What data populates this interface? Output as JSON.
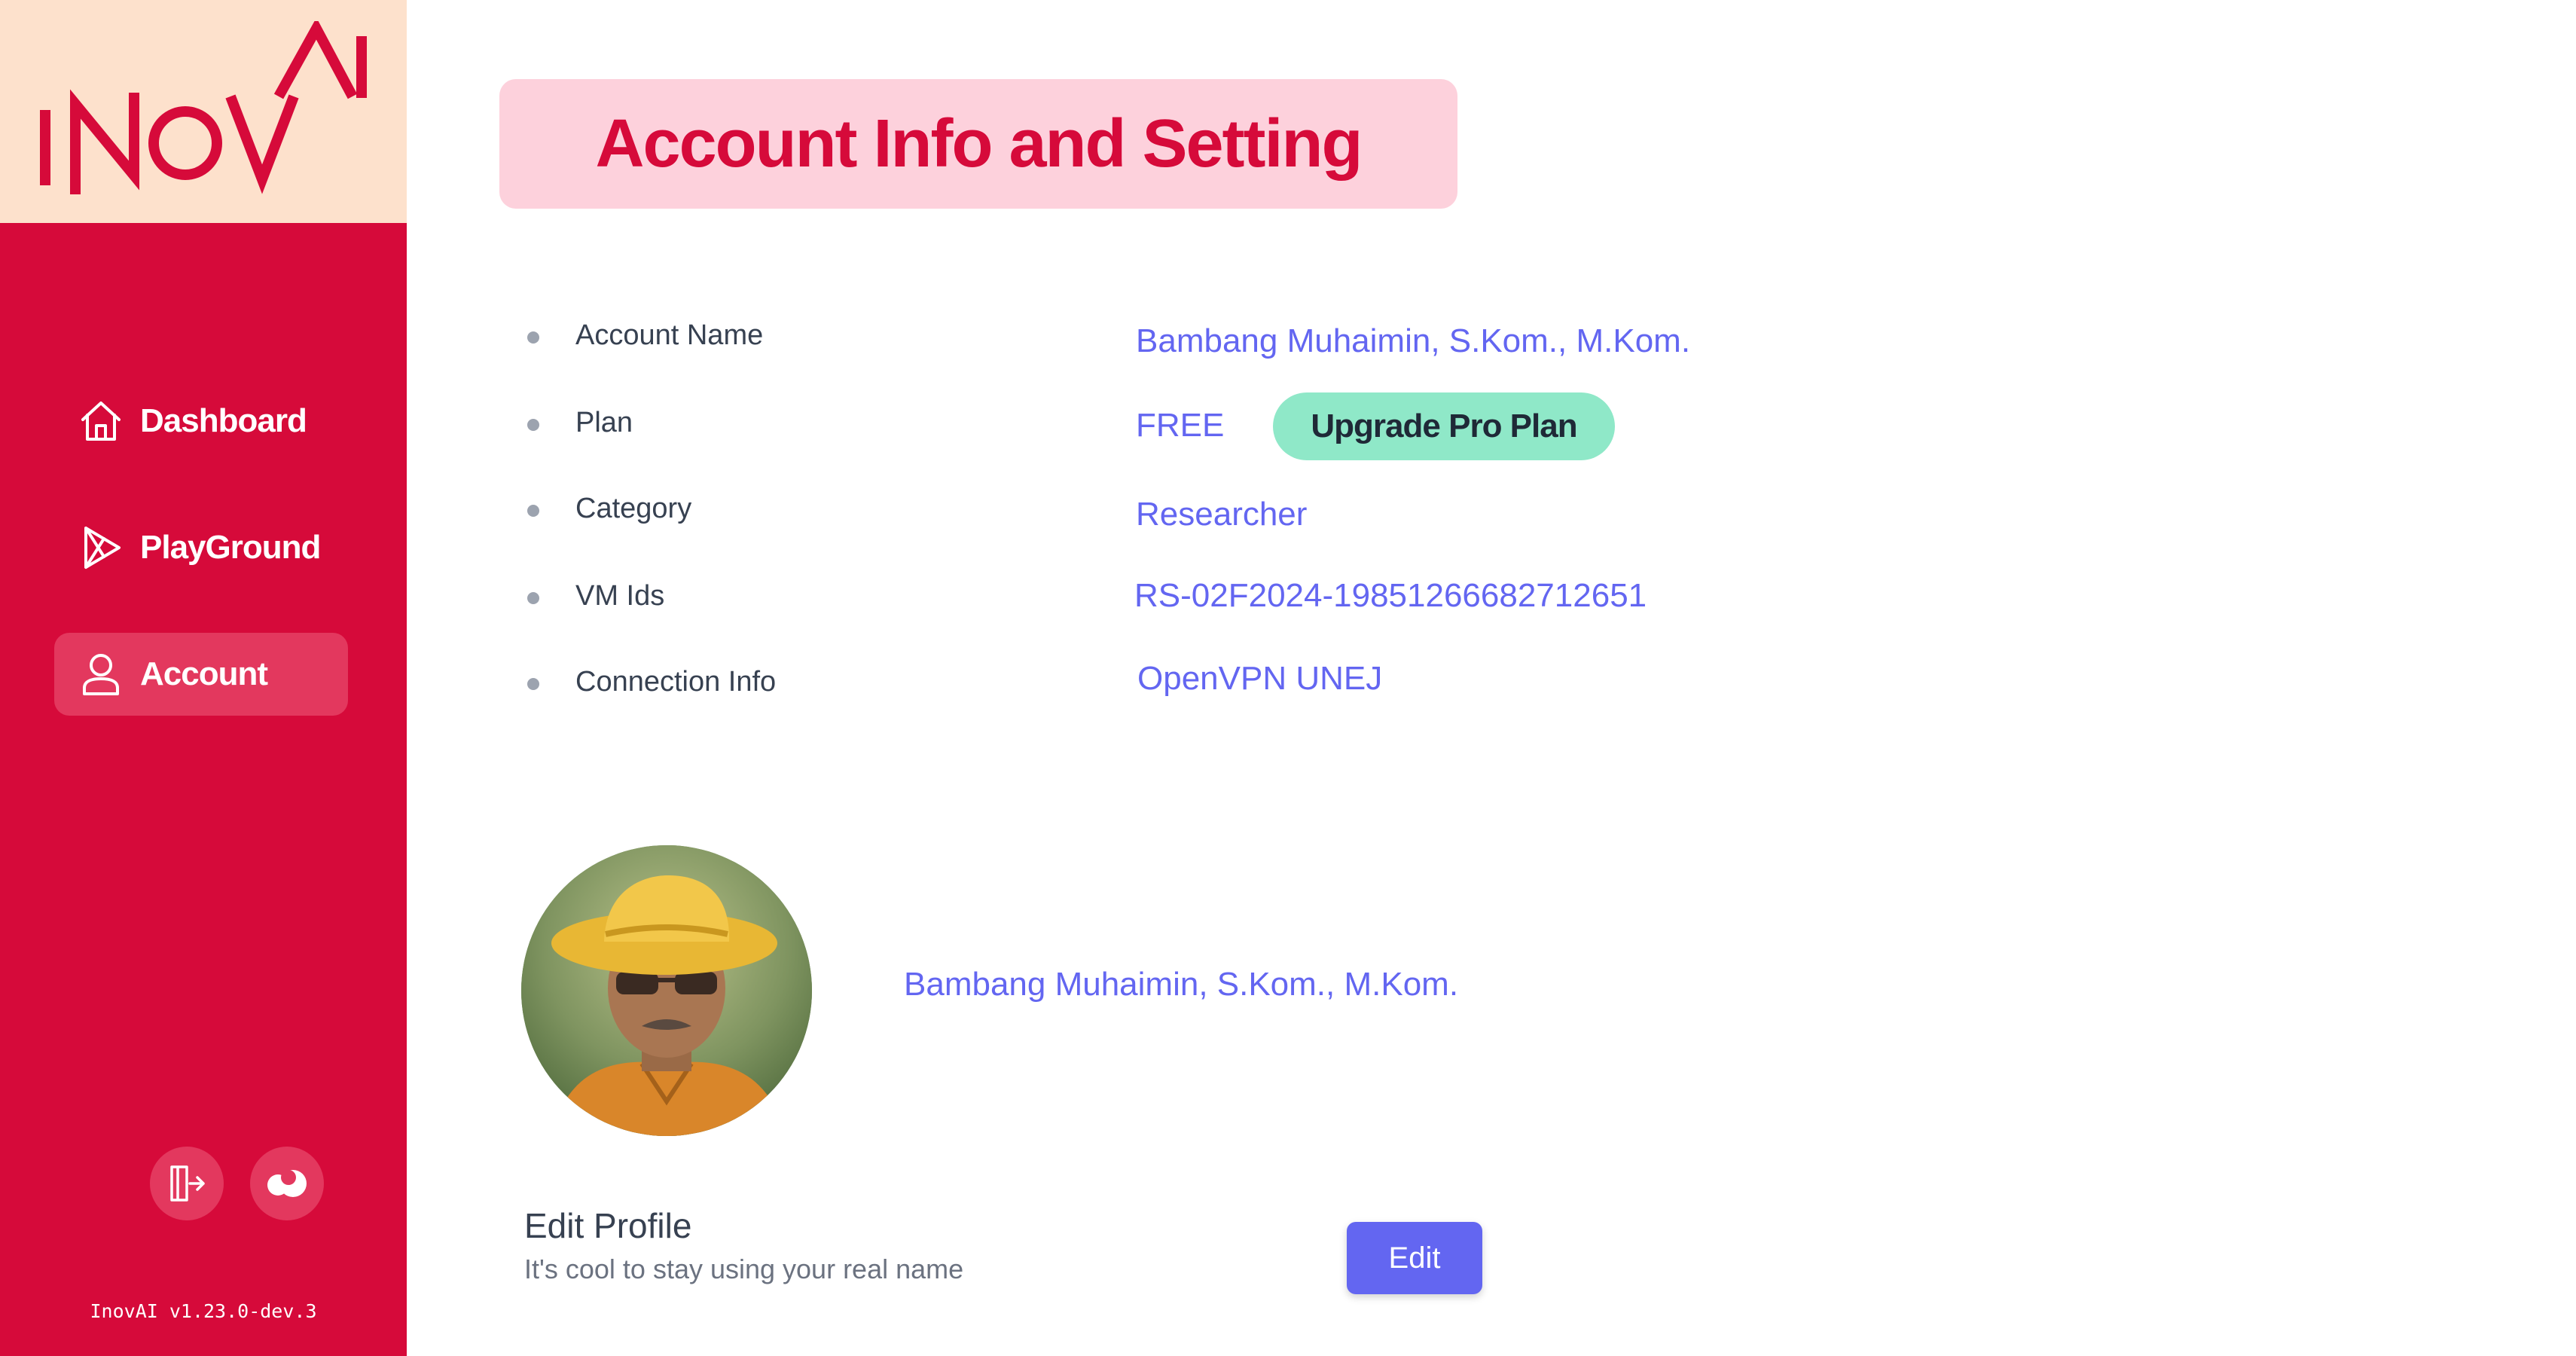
{
  "app": {
    "logo_text": "InovAI",
    "version": "InovAI v1.23.0-dev.3",
    "colors": {
      "brand": "#d60a3a",
      "accent": "#6366f1",
      "upgrade": "#8fe8c8"
    }
  },
  "sidebar": {
    "items": [
      {
        "label": "Dashboard",
        "icon": "home-icon"
      },
      {
        "label": "PlayGround",
        "icon": "play-icon"
      },
      {
        "label": "Account",
        "icon": "user-icon",
        "active": true
      }
    ],
    "footer_buttons": [
      {
        "icon": "logout-icon"
      },
      {
        "icon": "theme-toggle-icon"
      }
    ]
  },
  "main": {
    "title": "Account Info and Setting",
    "info": {
      "account_name_label": "Account Name",
      "account_name_value": "Bambang Muhaimin, S.Kom., M.Kom.",
      "plan_label": "Plan",
      "plan_value": "FREE",
      "upgrade_label": "Upgrade Pro Plan",
      "category_label": "Category",
      "category_value": "Researcher",
      "vm_label": "VM Ids",
      "vm_value": "RS-02F2024-19851266682712651",
      "connection_label": "Connection Info",
      "connection_value": "OpenVPN UNEJ"
    },
    "profile": {
      "name": "Bambang Muhaimin, S.Kom., M.Kom.",
      "edit_title": "Edit Profile",
      "edit_subtitle": "It's cool to stay using your real name",
      "edit_button": "Edit"
    }
  }
}
